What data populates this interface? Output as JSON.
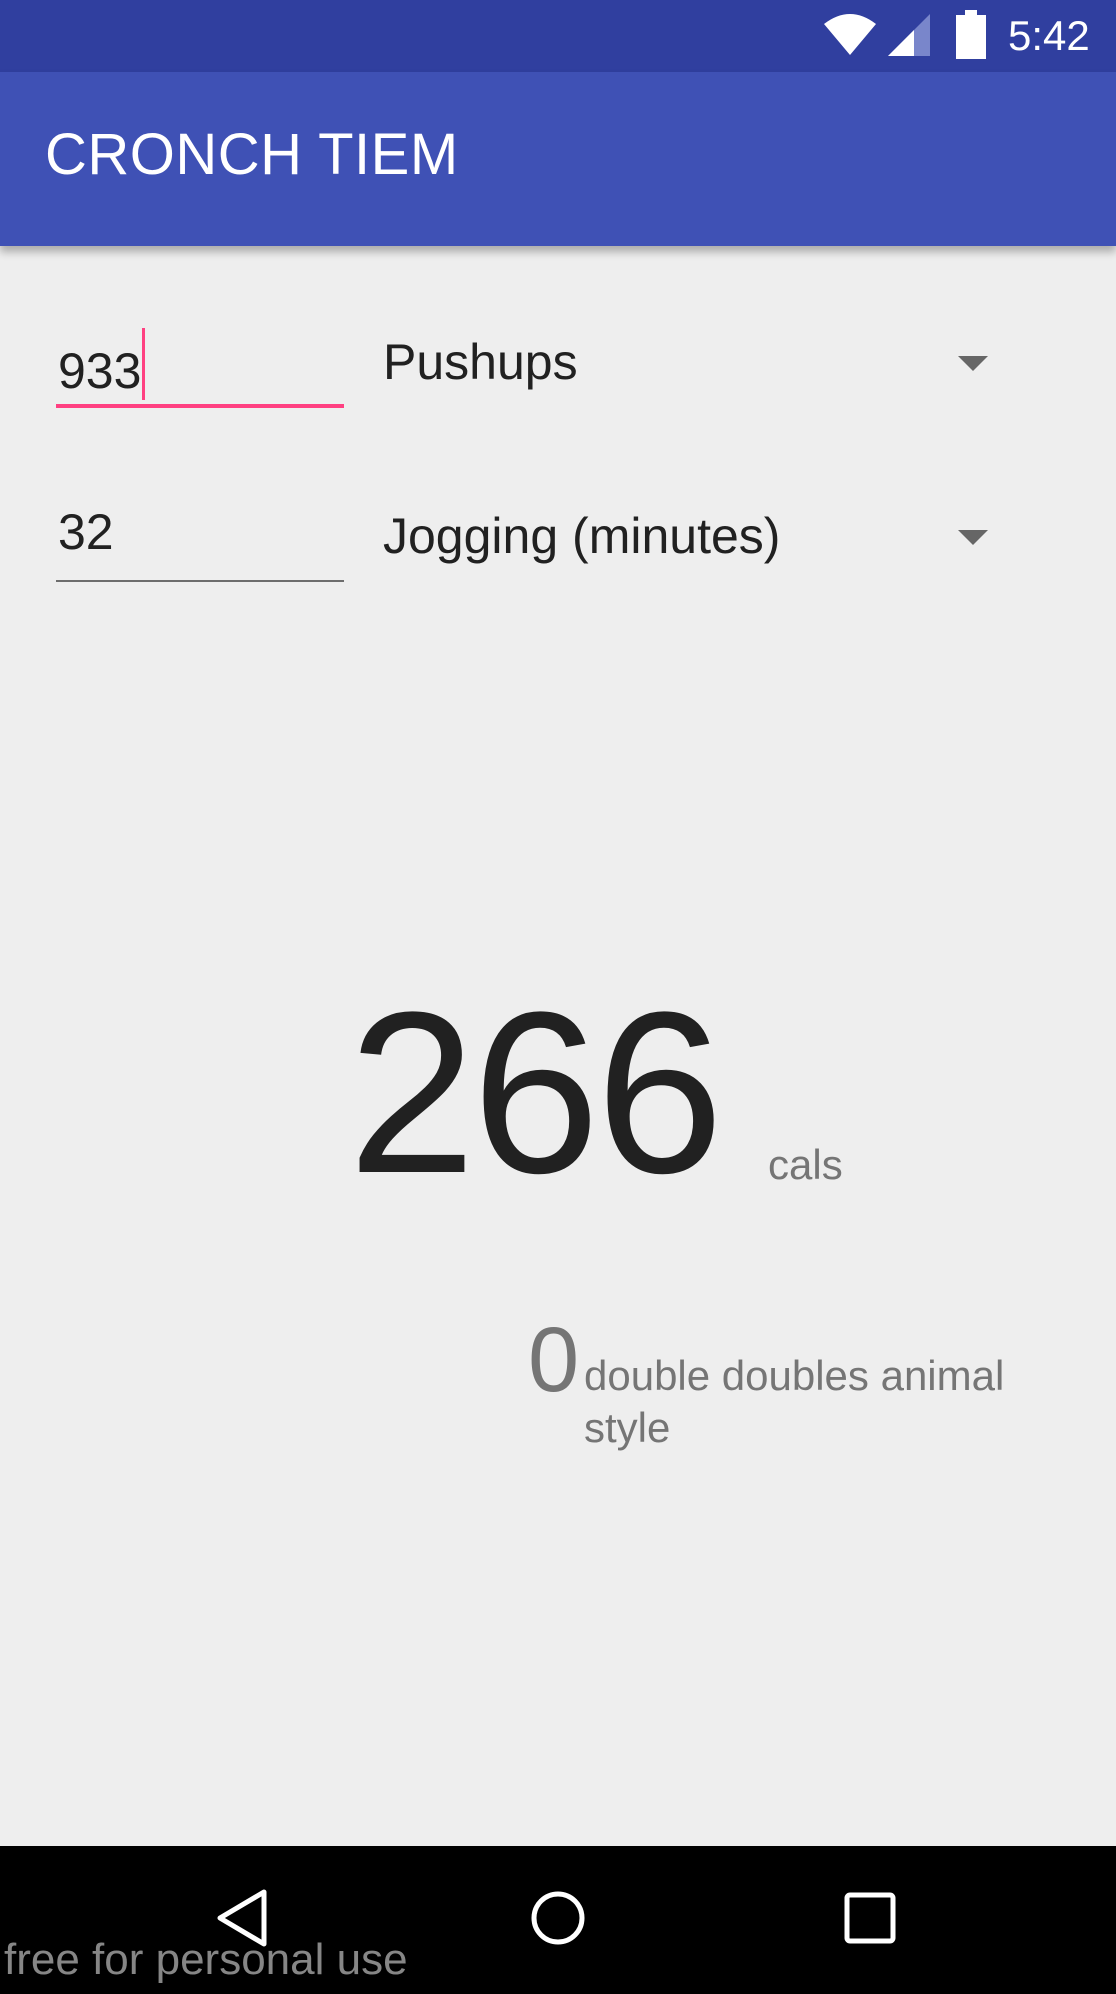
{
  "status_bar": {
    "time": "5:42",
    "icons": [
      "wifi-icon",
      "cell-signal-icon",
      "battery-icon"
    ]
  },
  "app_bar": {
    "title": "CRONCH TIEM"
  },
  "form": {
    "rows": [
      {
        "value": "933",
        "activity": "Pushups",
        "focused": true
      },
      {
        "value": "32",
        "activity": "Jogging (minutes)",
        "focused": false
      }
    ]
  },
  "result": {
    "calories": "266",
    "unit": "cals",
    "equivalent_count": "0",
    "equivalent_label": "double doubles animal style"
  },
  "nav_bar": {
    "buttons": [
      "back-icon",
      "home-icon",
      "recents-icon"
    ]
  },
  "watermark": "free for personal use",
  "colors": {
    "status_bar": "#303f9f",
    "app_bar": "#3f51b5",
    "accent": "#ff4081",
    "background": "#eeeeee"
  }
}
